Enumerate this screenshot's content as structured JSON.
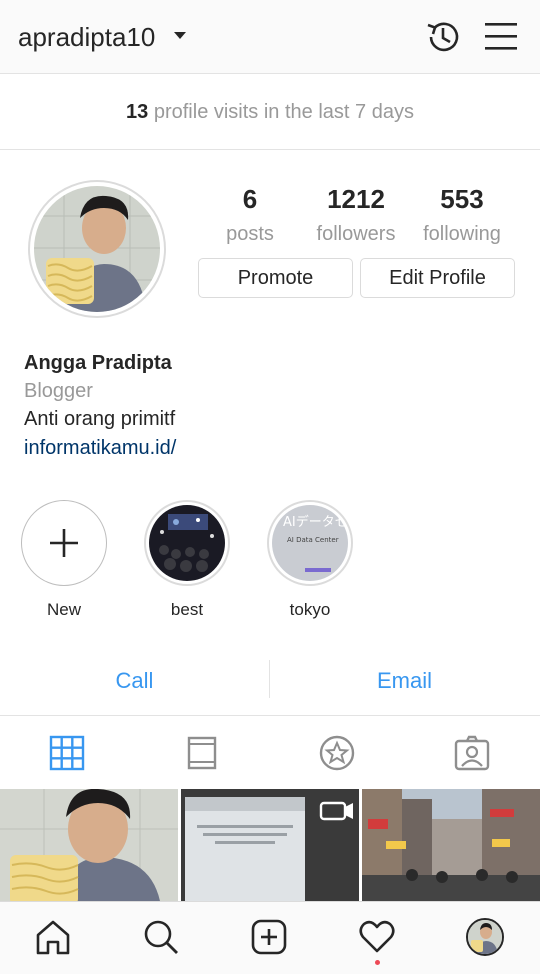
{
  "header": {
    "username": "apradipta10"
  },
  "insights": {
    "count": "13",
    "text": " profile visits in the last 7 days"
  },
  "stats": [
    {
      "value": "6",
      "label": "posts"
    },
    {
      "value": "1212",
      "label": "followers"
    },
    {
      "value": "553",
      "label": "following"
    }
  ],
  "buttons": {
    "promote": "Promote",
    "edit_profile": "Edit Profile"
  },
  "bio": {
    "name": "Angga Pradipta",
    "category": "Blogger",
    "text": "Anti orang primitf",
    "link": "informatikamu.id/"
  },
  "highlights": [
    {
      "label": "New"
    },
    {
      "label": "best"
    },
    {
      "label": "tokyo",
      "thumb_text": "AIデータセ",
      "thumb_subtext": "AI Data Center"
    }
  ],
  "contact": {
    "call": "Call",
    "email": "Email"
  },
  "colors": {
    "accent": "#3897f0",
    "link": "#003569",
    "muted": "#999999",
    "notification": "#ed4956"
  }
}
